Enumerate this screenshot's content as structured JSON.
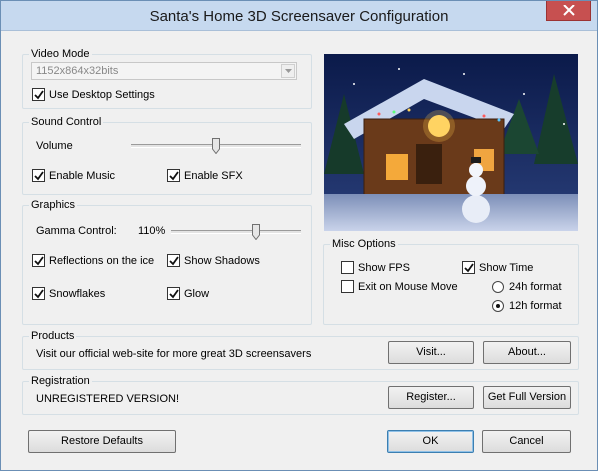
{
  "window": {
    "title": "Santa's Home 3D Screensaver Configuration"
  },
  "video_mode": {
    "label": "Video Mode",
    "resolution_value": "1152x864x32bits",
    "use_desktop_label": "Use Desktop Settings",
    "use_desktop_checked": true
  },
  "sound": {
    "label": "Sound Control",
    "volume_label": "Volume",
    "volume_level": 0.5,
    "enable_music_label": "Enable Music",
    "enable_music_checked": true,
    "enable_sfx_label": "Enable SFX",
    "enable_sfx_checked": true
  },
  "graphics": {
    "label": "Graphics",
    "gamma_label": "Gamma Control:",
    "gamma_value": "110%",
    "gamma_level": 0.65,
    "reflections_label": "Reflections on the ice",
    "reflections_checked": true,
    "shadows_label": "Show Shadows",
    "shadows_checked": true,
    "snowflakes_label": "Snowflakes",
    "snowflakes_checked": true,
    "glow_label": "Glow",
    "glow_checked": true
  },
  "misc": {
    "label": "Misc Options",
    "show_fps_label": "Show FPS",
    "show_fps_checked": false,
    "show_time_label": "Show Time",
    "show_time_checked": true,
    "exit_mouse_label": "Exit on Mouse Move",
    "exit_mouse_checked": false,
    "format_24_label": "24h format",
    "format_12_label": "12h format",
    "selected_format": "12h format"
  },
  "products": {
    "label": "Products",
    "text": "Visit our official web-site for more great 3D screensavers",
    "visit_label": "Visit...",
    "about_label": "About..."
  },
  "registration": {
    "label": "Registration",
    "status": "UNREGISTERED VERSION!",
    "register_label": "Register...",
    "full_version_label": "Get Full Version"
  },
  "footer": {
    "restore_label": "Restore Defaults",
    "ok_label": "OK",
    "cancel_label": "Cancel"
  },
  "colors": {
    "titlebar": "#c6d9ef",
    "close_button": "#c75050",
    "default_button_border": "#3c7fb1"
  },
  "icons": [
    "close-icon",
    "check-icon",
    "dropdown-arrow-icon",
    "slider-thumb-icon"
  ]
}
